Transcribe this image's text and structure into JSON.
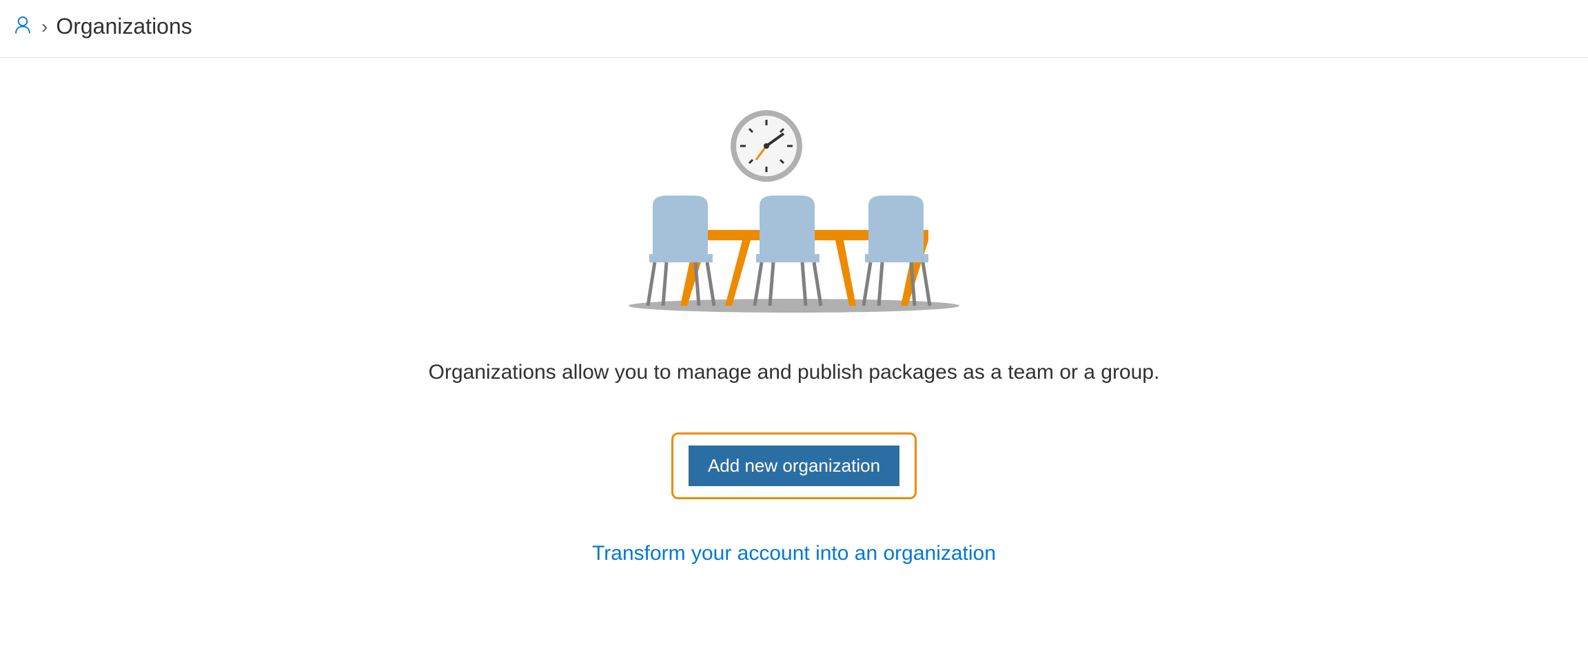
{
  "breadcrumb": {
    "current": "Organizations"
  },
  "main": {
    "description": "Organizations allow you to manage and publish packages as a team or a group.",
    "add_button_label": "Add new organization",
    "transform_link_label": "Transform your account into an organization"
  }
}
